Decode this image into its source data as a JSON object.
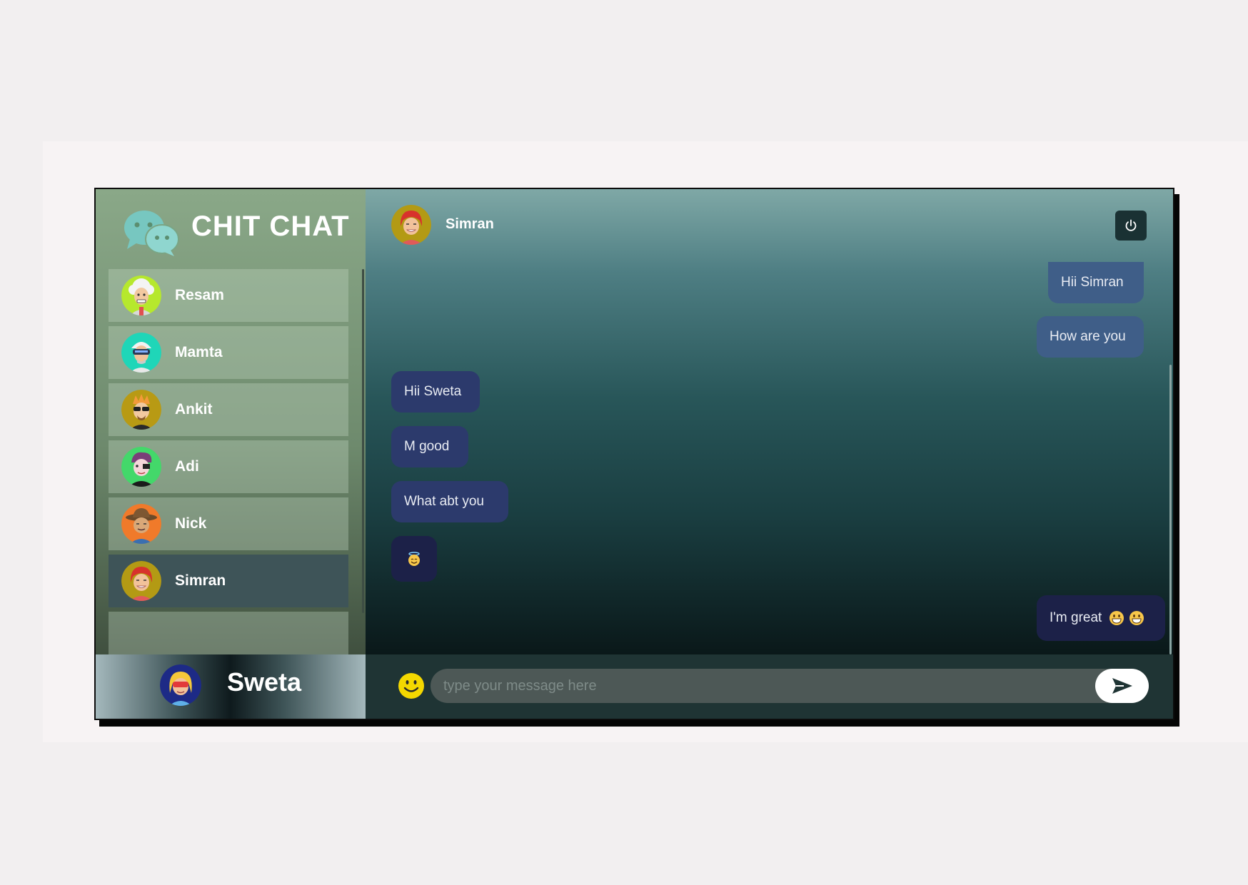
{
  "app": {
    "title": "CHIT CHAT",
    "logo_icon": "chat-bubbles-icon"
  },
  "contacts": [
    {
      "name": "Resam",
      "avatar": "avatar-resam-icon",
      "active": false
    },
    {
      "name": "Mamta",
      "avatar": "avatar-mamta-icon",
      "active": false
    },
    {
      "name": "Ankit",
      "avatar": "avatar-ankit-icon",
      "active": false
    },
    {
      "name": "Adi",
      "avatar": "avatar-adi-icon",
      "active": false
    },
    {
      "name": "Nick",
      "avatar": "avatar-nick-icon",
      "active": false
    },
    {
      "name": "Simran",
      "avatar": "avatar-simran-icon",
      "active": true
    }
  ],
  "current_user": {
    "name": "Sweta",
    "avatar": "avatar-sweta-icon"
  },
  "chat": {
    "peer_name": "Simran",
    "peer_avatar": "avatar-simran-icon",
    "logout_icon": "power-icon",
    "messages": [
      {
        "from": "me",
        "text": "Hii Simran"
      },
      {
        "from": "me",
        "text": "How are you"
      },
      {
        "from": "peer",
        "text": "Hii Sweta"
      },
      {
        "from": "peer",
        "text": "M good"
      },
      {
        "from": "peer",
        "text": "What abt you"
      },
      {
        "from": "peer",
        "text": "",
        "emoji": "smiling-face-with-halo-emoji"
      },
      {
        "from": "me",
        "text": "I'm great",
        "emoji": "grinning-face-emoji"
      }
    ]
  },
  "composer": {
    "placeholder": "type your message here",
    "value": "",
    "emoji_icon": "smiley-icon",
    "send_icon": "send-arrow-icon"
  },
  "colors": {
    "sidebar_top": "#8aa888",
    "active_contact": "#3e5458",
    "outgoing_bubble": "#3f5e88",
    "incoming_bubble": "#2c3a6c",
    "composer_bg": "#1f3434",
    "emoji_yellow": "#f4d800"
  }
}
